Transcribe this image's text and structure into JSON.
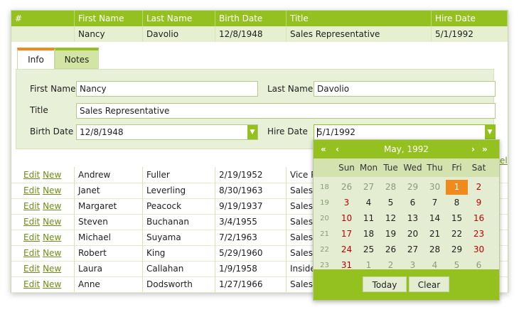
{
  "grid": {
    "headers": [
      "#",
      "First Name",
      "Last Name",
      "Birth Date",
      "Title",
      "Hire Date"
    ],
    "selected_row": {
      "first": "Nancy",
      "last": "Davolio",
      "birth": "12/8/1948",
      "title": "Sales Representative",
      "hire": "5/1/1992"
    },
    "row_link_edit": "Edit",
    "row_link_new": "New",
    "rows": [
      {
        "first": "Andrew",
        "last": "Fuller",
        "birth": "2/19/1952",
        "title": "Vice P"
      },
      {
        "first": "Janet",
        "last": "Leverling",
        "birth": "8/30/1963",
        "title": "Sales R"
      },
      {
        "first": "Margaret",
        "last": "Peacock",
        "birth": "9/19/1937",
        "title": "Sales R"
      },
      {
        "first": "Steven",
        "last": "Buchanan",
        "birth": "3/4/1955",
        "title": "Sales M"
      },
      {
        "first": "Michael",
        "last": "Suyama",
        "birth": "7/2/1963",
        "title": "Sales R"
      },
      {
        "first": "Robert",
        "last": "King",
        "birth": "5/29/1960",
        "title": "Sales R"
      },
      {
        "first": "Laura",
        "last": "Callahan",
        "birth": "1/9/1958",
        "title": "Inside"
      },
      {
        "first": "Anne",
        "last": "Dodsworth",
        "birth": "1/27/1966",
        "title": "Sales R"
      }
    ],
    "partial_link": "el"
  },
  "edit_form": {
    "tabs": [
      "Info",
      "Notes"
    ],
    "active_tab": "Info",
    "first_name_label": "First Name",
    "first_name_value": "Nancy",
    "last_name_label": "Last Name",
    "last_name_value": "Davolio",
    "title_label": "Title",
    "title_value": "Sales Representative",
    "birth_date_label": "Birth Date",
    "birth_date_value": "12/8/1948",
    "hire_date_label": "Hire Date",
    "hire_date_value": "5/1/1992"
  },
  "calendar": {
    "month_title": "May, 1992",
    "nav_prev_year": "«",
    "nav_prev": "‹",
    "nav_next": "›",
    "nav_next_year": "»",
    "day_names": [
      "Sun",
      "Mon",
      "Tue",
      "Wed",
      "Thu",
      "Fri",
      "Sat"
    ],
    "weeks": [
      {
        "num": "18",
        "days": [
          "26",
          "27",
          "28",
          "29",
          "30",
          "1",
          "2"
        ]
      },
      {
        "num": "19",
        "days": [
          "3",
          "4",
          "5",
          "6",
          "7",
          "8",
          "9"
        ]
      },
      {
        "num": "20",
        "days": [
          "10",
          "11",
          "12",
          "13",
          "14",
          "15",
          "16"
        ]
      },
      {
        "num": "21",
        "days": [
          "17",
          "18",
          "19",
          "20",
          "21",
          "22",
          "23"
        ]
      },
      {
        "num": "22",
        "days": [
          "24",
          "25",
          "26",
          "27",
          "28",
          "29",
          "30"
        ]
      },
      {
        "num": "23",
        "days": [
          "31",
          "1",
          "2",
          "3",
          "4",
          "5",
          "6"
        ]
      }
    ],
    "selected_day": "1",
    "today_label": "Today",
    "clear_label": "Clear"
  },
  "colors": {
    "accent": "#94c11f",
    "highlight": "#f18a1d",
    "weekend": "#c00000"
  }
}
